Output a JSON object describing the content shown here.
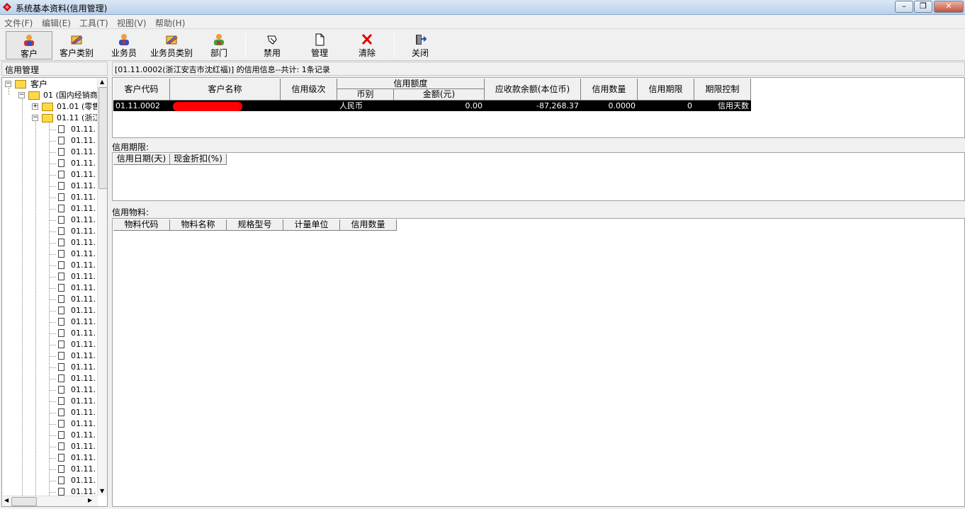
{
  "window": {
    "title": "系统基本资料(信用管理)",
    "minimize": "–",
    "restore": "❐",
    "close": "✕"
  },
  "menu": [
    "文件(F)",
    "编辑(E)",
    "工具(T)",
    "视图(V)",
    "帮助(H)"
  ],
  "toolbar": [
    {
      "label": "客户",
      "icon": "customer-icon"
    },
    {
      "label": "客户类别",
      "icon": "customer-category-icon"
    },
    {
      "label": "业务员",
      "icon": "salesperson-icon"
    },
    {
      "label": "业务员类别",
      "icon": "salesperson-category-icon"
    },
    {
      "label": "部门",
      "icon": "department-icon"
    },
    {
      "label": "禁用",
      "icon": "disable-icon"
    },
    {
      "label": "管理",
      "icon": "manage-icon"
    },
    {
      "label": "清除",
      "icon": "clear-icon"
    },
    {
      "label": "关闭",
      "icon": "close-door-icon"
    }
  ],
  "left_panel": {
    "title": "信用管理",
    "tree": {
      "root": "客户",
      "level1": "01 (国内经销商",
      "level2": [
        "01.01 (零售",
        "01.11 (浙江"
      ],
      "leaf_label": "01.11.",
      "leaf_count": 33
    }
  },
  "info_line": "[01.11.0002(浙江安吉市沈红福)] 的信用信息--共计: 1条记录",
  "credit_table": {
    "headers": {
      "customer_code": "客户代码",
      "customer_name": "客户名称",
      "credit_level": "信用级次",
      "credit_limit": "信用额度",
      "currency": "币别",
      "amount": "金额(元)",
      "receivable_balance": "应收款余额(本位币)",
      "credit_qty": "信用数量",
      "credit_term": "信用期限",
      "term_control": "期限控制"
    },
    "rows": [
      {
        "customer_code": "01.11.0002",
        "customer_name": "",
        "credit_level": "",
        "currency": "人民币",
        "amount": "0.00",
        "receivable_balance": "-87,268.37",
        "credit_qty": "0.0000",
        "credit_term": "0",
        "term_control": "信用天数"
      }
    ]
  },
  "credit_term_section": {
    "label": "信用期限:",
    "headers": [
      "信用日期(天)",
      "现金折扣(%)"
    ]
  },
  "credit_material_section": {
    "label": "信用物料:",
    "headers": [
      "物料代码",
      "物料名称",
      "规格型号",
      "计量单位",
      "信用数量"
    ]
  },
  "colors": {
    "selected_row": "#000000",
    "redacted": "#ff0000",
    "folder": "#ffd84a"
  }
}
